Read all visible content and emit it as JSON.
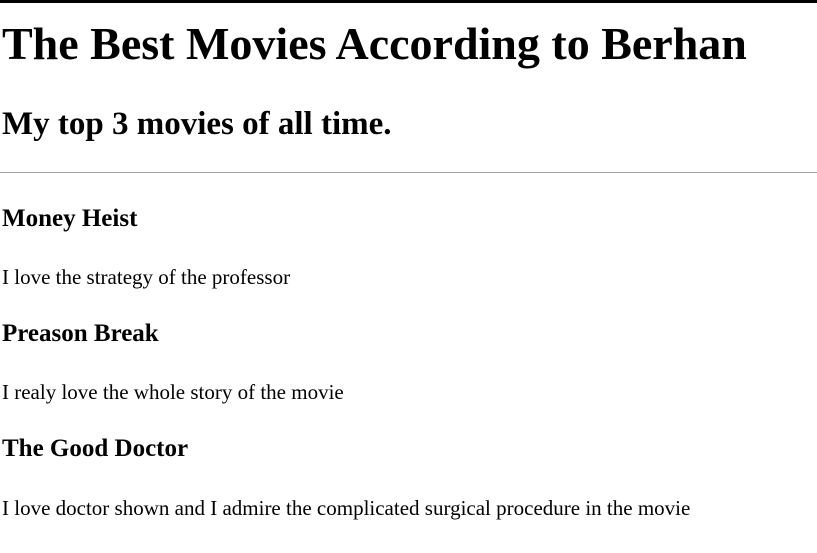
{
  "page": {
    "title": "The Best Movies According to Berhan",
    "subtitle": "My top 3 movies of all time."
  },
  "movies": [
    {
      "title": "Money Heist",
      "description": "I love the strategy of the professor"
    },
    {
      "title": "Preason Break",
      "description": "I realy love the whole story of the movie"
    },
    {
      "title": "The Good Doctor",
      "description": "I love doctor shown and I admire the complicated surgical procedure in the movie"
    }
  ]
}
